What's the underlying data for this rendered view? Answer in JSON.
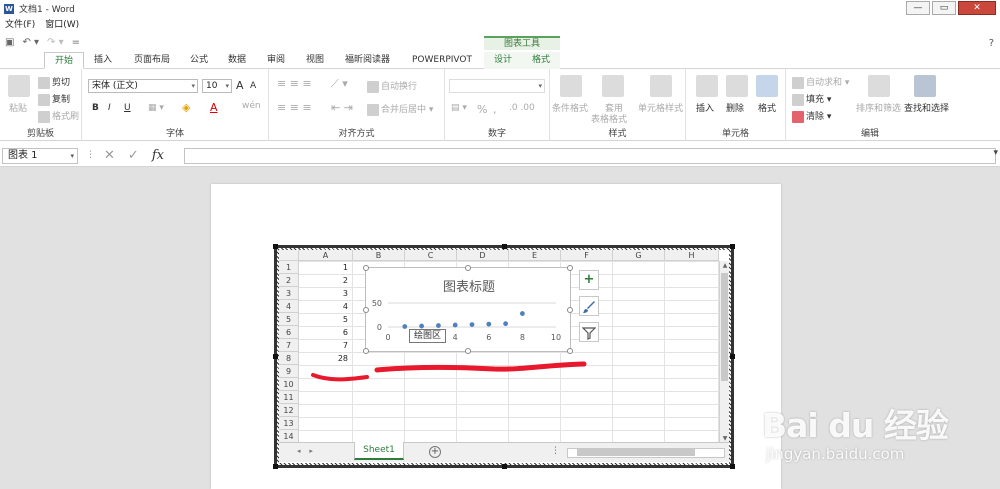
{
  "window": {
    "title": "文档1 - Word",
    "app_icon": "W",
    "controls": [
      "—",
      "▭",
      "✕"
    ]
  },
  "menubar": {
    "items": [
      "文件(F)",
      "窗口(W)"
    ]
  },
  "qat": {
    "save_icon": "save-icon",
    "undo_label": "↶ ▾",
    "redo_label": "↷ ▾",
    "customize_label": "="
  },
  "tabs": {
    "context_header": "图表工具",
    "items": [
      "开始",
      "插入",
      "页面布局",
      "公式",
      "数据",
      "审阅",
      "视图",
      "福昕阅读器",
      "POWERPIVOT",
      "设计",
      "格式"
    ],
    "help": "?"
  },
  "ribbon": {
    "clipboard": {
      "label": "剪贴板",
      "paste": "粘贴",
      "cut": "剪切",
      "copy": "复制",
      "format_painter": "格式刷"
    },
    "font": {
      "label": "字体",
      "font_name": "宋体 (正文)",
      "font_size": "10",
      "grow": "A",
      "shrink": "A",
      "bold": "B",
      "italic": "I",
      "underline": "U",
      "phonetic": "wén"
    },
    "alignment": {
      "label": "对齐方式",
      "wrap": "自动换行",
      "merge": "合并后居中"
    },
    "number": {
      "label": "数字",
      "percent": "%",
      "comma": ","
    },
    "styles": {
      "label": "样式",
      "conditional": "条件格式",
      "table_line1": "套用",
      "table_line2": "表格格式",
      "cell_styles": "单元格样式"
    },
    "cells": {
      "label": "单元格",
      "insert": "插入",
      "delete": "删除",
      "format": "格式"
    },
    "editing": {
      "label": "编辑",
      "autosum": "自动求和",
      "fill": "填充",
      "clear": "清除",
      "sort": "排序和筛选",
      "find": "查找和选择"
    }
  },
  "formula_bar": {
    "name_box": "图表 1",
    "cancel": "✕",
    "enter": "✓",
    "fx": "fx",
    "value": ""
  },
  "sheet": {
    "columns": [
      "A",
      "B",
      "C",
      "D",
      "E",
      "F",
      "G",
      "H"
    ],
    "rows": [
      "1",
      "2",
      "3",
      "4",
      "5",
      "6",
      "7",
      "8",
      "9",
      "10",
      "11",
      "12",
      "13",
      "14"
    ],
    "column_a_values": [
      "1",
      "2",
      "3",
      "4",
      "5",
      "6",
      "7",
      "28"
    ],
    "tab_name": "Sheet1",
    "add_sheet": "+",
    "nav_prev": "◂",
    "nav_next": "▸",
    "dots": "⋮"
  },
  "chart_data": {
    "type": "scatter",
    "title": "图表标题",
    "xlabel": "",
    "ylabel": "",
    "xlim": [
      0,
      10
    ],
    "ylim": [
      0,
      50
    ],
    "x_ticks": [
      "0",
      "2",
      "4",
      "6",
      "8",
      "10"
    ],
    "y_ticks": [
      "0",
      "50"
    ],
    "x": [
      1,
      2,
      3,
      4,
      5,
      6,
      7,
      8
    ],
    "y": [
      1,
      2,
      3,
      4,
      5,
      6,
      7,
      28
    ],
    "marker_color": "#4f81bd",
    "grid": true,
    "tooltip": "绘图区"
  },
  "chart_tools": {
    "add_element": "+",
    "styles": "brush-icon",
    "filter": "filter-icon"
  },
  "annotation": {
    "color": "#e8192c"
  },
  "watermark": {
    "main": "Bai du 经验",
    "sub": "jingyan.baidu.com"
  },
  "colors": {
    "accent": "#2d7d3a",
    "word_blue": "#2b579a"
  }
}
